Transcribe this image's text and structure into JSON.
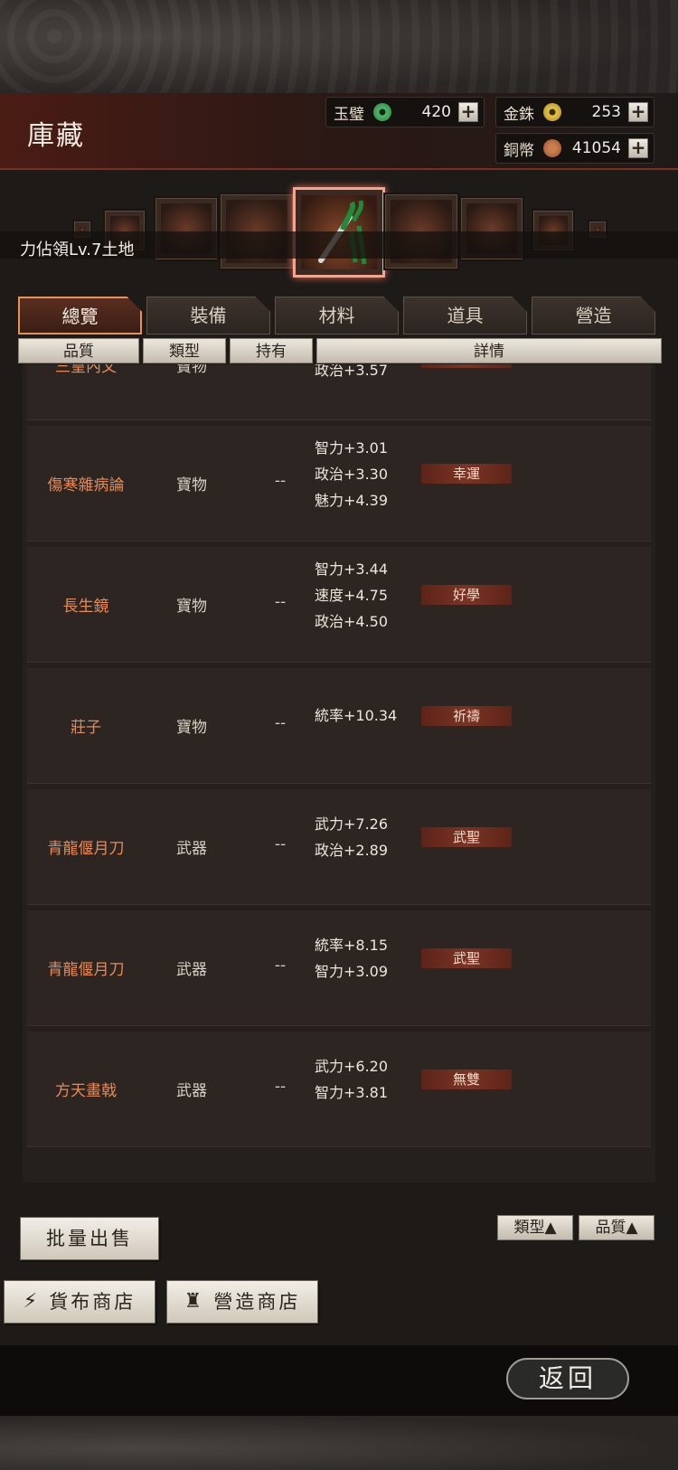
{
  "header": {
    "title": "庫藏",
    "currencies": [
      {
        "label": "玉璧",
        "value": "420",
        "icon": "jade-disc-icon",
        "color": "#3fa05a"
      },
      {
        "label": "金銖",
        "value": "253",
        "icon": "gold-coin-icon",
        "color": "#d4b43a"
      },
      {
        "label": "銅幣",
        "value": "41054",
        "icon": "copper-coin-icon",
        "color": "#b8663a"
      }
    ],
    "plus": "+"
  },
  "banner": {
    "territory": "力佔領Lv.7土地"
  },
  "tabs": [
    "總覽",
    "裝備",
    "材料",
    "道具",
    "營造"
  ],
  "columns": [
    "品質",
    "類型",
    "持有",
    "詳情"
  ],
  "items": [
    {
      "name": "三皇內文",
      "type": "寶物",
      "held": "--",
      "stats": [
        "政治+3.57"
      ],
      "trait": "學識"
    },
    {
      "name": "傷寒雜病論",
      "type": "寶物",
      "held": "--",
      "stats": [
        "智力+3.01",
        "政治+3.30",
        "魅力+4.39"
      ],
      "trait": "幸運"
    },
    {
      "name": "長生鏡",
      "type": "寶物",
      "held": "--",
      "stats": [
        "智力+3.44",
        "速度+4.75",
        "政治+4.50"
      ],
      "trait": "好學"
    },
    {
      "name": "莊子",
      "type": "寶物",
      "held": "--",
      "stats": [
        "統率+10.34"
      ],
      "trait": "祈禱"
    },
    {
      "name": "青龍偃月刀",
      "type": "武器",
      "held": "--",
      "stats": [
        "武力+7.26",
        "政治+2.89"
      ],
      "trait": "武聖"
    },
    {
      "name": "青龍偃月刀",
      "type": "武器",
      "held": "--",
      "stats": [
        "統率+8.15",
        "智力+3.09"
      ],
      "trait": "武聖"
    },
    {
      "name": "方天畫戟",
      "type": "武器",
      "held": "--",
      "stats": [
        "武力+6.20",
        "智力+3.81"
      ],
      "trait": "無雙"
    }
  ],
  "sort": {
    "type": "類型▲",
    "quality": "品質▲"
  },
  "actions": {
    "bulk_sell": "批量出售",
    "currency_shop": "貨布商店",
    "build_shop": "營造商店",
    "back": "返回"
  }
}
